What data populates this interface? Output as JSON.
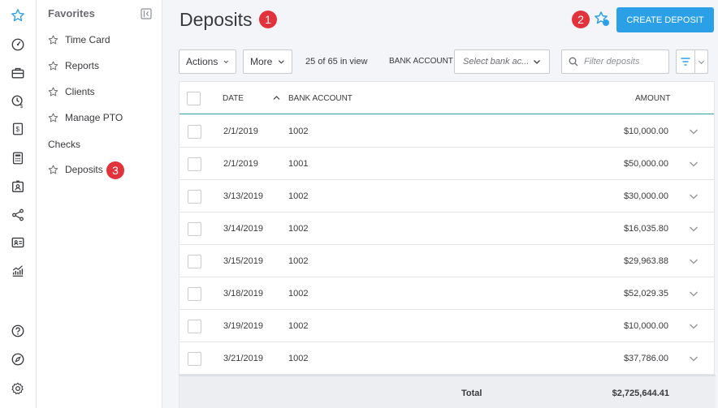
{
  "favorites": {
    "title": "Favorites",
    "items": [
      {
        "label": "Time Card"
      },
      {
        "label": "Reports"
      },
      {
        "label": "Clients"
      },
      {
        "label": "Manage PTO"
      }
    ],
    "plain_item": "Checks",
    "active_item": "Deposits"
  },
  "badges": {
    "one": "1",
    "two": "2",
    "three": "3"
  },
  "header": {
    "title": "Deposits",
    "create_label": "CREATE DEPOSIT"
  },
  "toolbar": {
    "actions_label": "Actions",
    "more_label": "More",
    "count_text": "25 of 65 in view",
    "bank_account_label": "BANK ACCOUNT",
    "bank_select_placeholder": "Select bank ac...",
    "filter_placeholder": "Filter deposits"
  },
  "table": {
    "columns": {
      "date": "DATE",
      "bank_account": "BANK ACCOUNT",
      "amount": "AMOUNT"
    },
    "rows": [
      {
        "date": "2/1/2019",
        "bank": "1002",
        "amount": "$10,000.00"
      },
      {
        "date": "2/1/2019",
        "bank": "1001",
        "amount": "$50,000.00"
      },
      {
        "date": "3/13/2019",
        "bank": "1002",
        "amount": "$30,000.00"
      },
      {
        "date": "3/14/2019",
        "bank": "1002",
        "amount": "$16,035.80"
      },
      {
        "date": "3/15/2019",
        "bank": "1002",
        "amount": "$29,963.88"
      },
      {
        "date": "3/18/2019",
        "bank": "1002",
        "amount": "$52,029.35"
      },
      {
        "date": "3/19/2019",
        "bank": "1002",
        "amount": "$10,000.00"
      },
      {
        "date": "3/21/2019",
        "bank": "1002",
        "amount": "$37,786.00"
      }
    ],
    "total_label": "Total",
    "total_value": "$2,725,644.41"
  },
  "colors": {
    "accent": "#2ca0e6",
    "badge": "#e2323c",
    "teal": "#34a3a0"
  },
  "icons": {
    "rail": [
      "star-icon",
      "dashboard-icon",
      "briefcase-icon",
      "clock-dollar-icon",
      "invoice-icon",
      "calculator-icon",
      "id-badge-icon",
      "share-icon",
      "contact-card-icon",
      "chart-icon",
      "help-icon",
      "compass-icon",
      "settings-icon"
    ]
  }
}
